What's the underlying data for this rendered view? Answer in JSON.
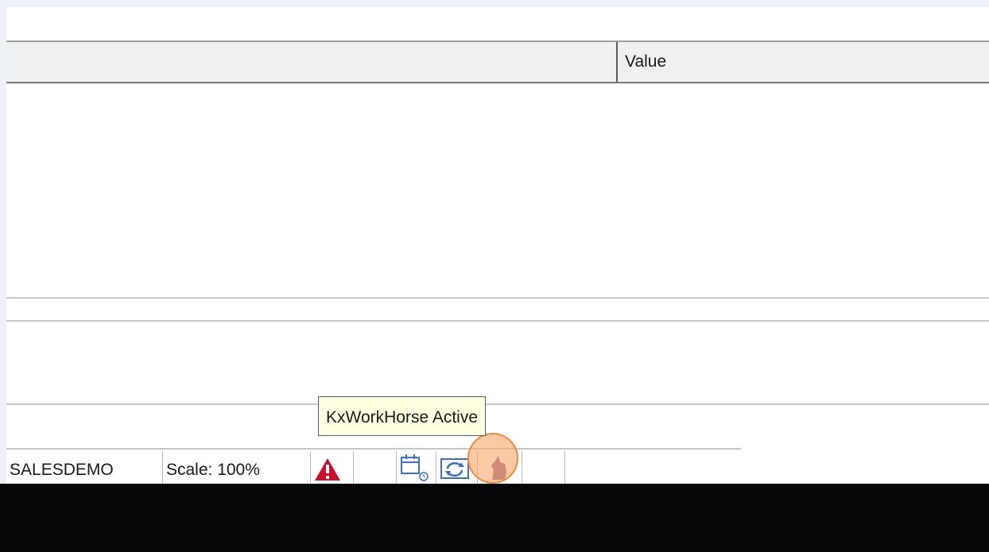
{
  "grid": {
    "columns": [
      "",
      "Value"
    ]
  },
  "statusbar": {
    "database": "SALESDEMO",
    "scale": "Scale: 100%",
    "icons": [
      "warning-icon",
      "calendar-clock-icon",
      "sync-icon",
      "workhorse-icon"
    ]
  },
  "tooltip": {
    "text": "KxWorkHorse Active"
  },
  "colors": {
    "warning": "#c8102e",
    "icon_blue": "#3a6fc4",
    "workhorse": "#8e5a8a",
    "pointer_ring": "#f08a3c",
    "tooltip_bg": "#ffffe1"
  }
}
